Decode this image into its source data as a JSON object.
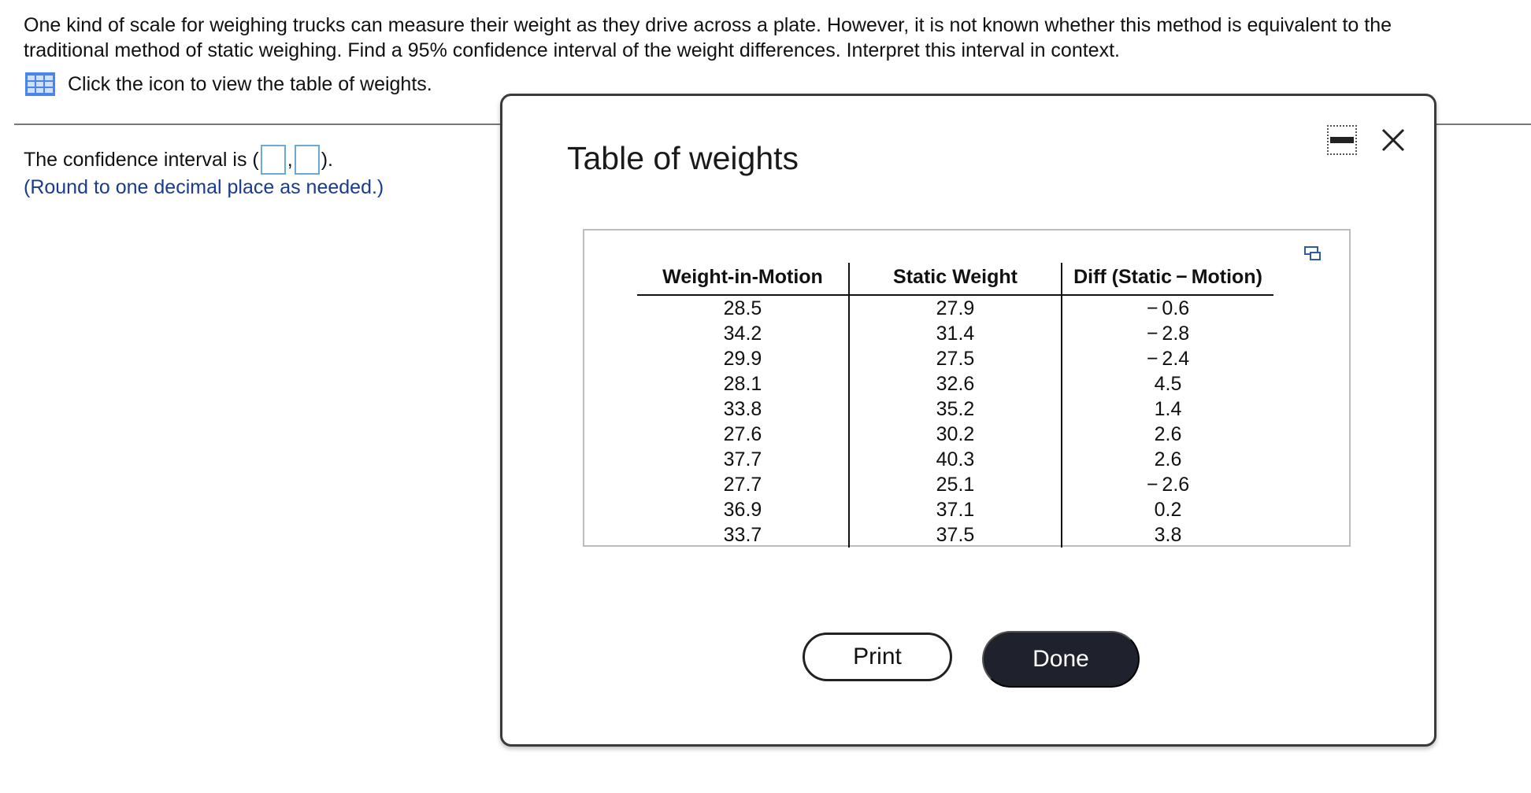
{
  "question": {
    "text": "One kind of scale for weighing trucks can measure their weight as they drive across a plate. However, it is not known whether this method is equivalent to the traditional method of static weighing. Find a 95% confidence interval of the weight differences. Interpret this interval in context.",
    "table_link": "Click the icon to view the table of weights."
  },
  "answer": {
    "prefix": "The confidence interval is (",
    "separator": ",",
    "suffix": ").",
    "note": "(Round to one decimal place as needed.)"
  },
  "modal": {
    "title": "Table of weights",
    "table": {
      "headers": [
        "Weight-in-Motion",
        "Static Weight",
        "Diff (Static − Motion)"
      ],
      "rows": [
        [
          "28.5",
          "27.9",
          "− 0.6"
        ],
        [
          "34.2",
          "31.4",
          "− 2.8"
        ],
        [
          "29.9",
          "27.5",
          "− 2.4"
        ],
        [
          "28.1",
          "32.6",
          "4.5"
        ],
        [
          "33.8",
          "35.2",
          "1.4"
        ],
        [
          "27.6",
          "30.2",
          "2.6"
        ],
        [
          "37.7",
          "40.3",
          "2.6"
        ],
        [
          "27.7",
          "25.1",
          "− 2.6"
        ],
        [
          "36.9",
          "37.1",
          "0.2"
        ],
        [
          "33.7",
          "37.5",
          "3.8"
        ]
      ]
    },
    "print_label": "Print",
    "done_label": "Done"
  },
  "icons": {
    "table_icon": "table-grid-icon",
    "minimize": "minimize-icon",
    "close": "close-icon",
    "copy": "copy-icon"
  },
  "colors": {
    "accent_blue": "#4a86e8",
    "note_blue": "#1a3c8c",
    "done_bg": "#1f222c",
    "input_border": "#6aa9d8"
  }
}
